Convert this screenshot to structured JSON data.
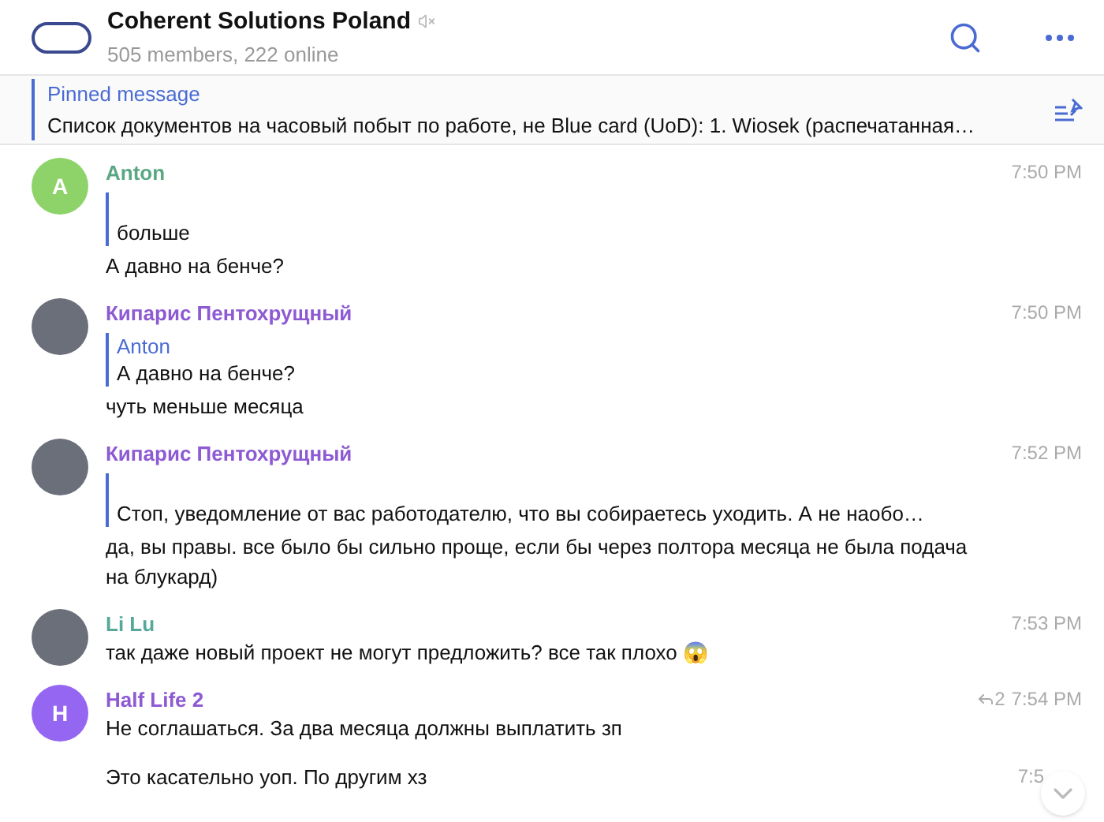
{
  "header": {
    "title": "Coherent Solutions Poland",
    "muted": true,
    "subtitle": "505 members, 222 online"
  },
  "pinned": {
    "label": "Pinned message",
    "text": "Список документов на часовый побыт по работе, не Blue card (UoD): 1. Wiosek (распечатанная…"
  },
  "messages": [
    {
      "author": "Anton",
      "color": "#5aa784",
      "avatar": {
        "kind": "letter",
        "letter": "A",
        "color": "#8ed36a"
      },
      "time": "7:50 PM",
      "reply": {
        "text": "больше"
      },
      "text": "А давно на бенче?"
    },
    {
      "author": "Кипарис Пентохрущный",
      "color": "#8d5ad3",
      "avatar": {
        "kind": "photo"
      },
      "time": "7:50 PM",
      "reply": {
        "name": "Anton",
        "text": "А давно на бенче?"
      },
      "text": "чуть меньше месяца"
    },
    {
      "author": "Кипарис Пентохрущный",
      "color": "#8d5ad3",
      "avatar": {
        "kind": "photo"
      },
      "time": "7:52 PM",
      "reply": {
        "text": "Стоп, уведомление от вас работодателю, что вы собираетесь уходить. А не наобо…"
      },
      "text": "да, вы правы. все было бы сильно проще, если бы через полтора месяца не была подача на блукард)"
    },
    {
      "author": "Li Lu",
      "color": "#55a89a",
      "avatar": {
        "kind": "photo"
      },
      "time": "7:53 PM",
      "text": "так даже новый проект не могут предложить? все так плохо 😱"
    },
    {
      "author": "Half Life 2",
      "color": "#8d5ad3",
      "avatar": {
        "kind": "letter",
        "letter": "H",
        "color": "#9466f2"
      },
      "time": "7:54 PM",
      "replies": "2",
      "text": "Не соглашаться. За два месяца должны выплатить зп"
    },
    {
      "time": "7:5",
      "text": "Это касательно уоп. По другим хз"
    }
  ]
}
